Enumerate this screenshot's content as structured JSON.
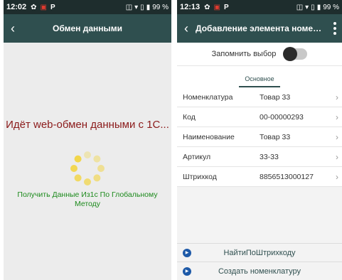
{
  "left": {
    "status": {
      "time": "12:02",
      "battery": "99 %"
    },
    "appbar": {
      "back_glyph": "‹",
      "title": "Обмен данными"
    },
    "message": "Идёт web-обмен данными с 1С...",
    "spinner_icon": "loading-spinner-icon",
    "sync_text": "Получить Данные Из1с По Глобальному Методу"
  },
  "right": {
    "status": {
      "time": "12:13",
      "battery": "99 %"
    },
    "appbar": {
      "back_glyph": "‹",
      "title": "Добавление элемента номенк..."
    },
    "remember": {
      "label": "Запомнить выбор",
      "checked": false
    },
    "tab": "Основное",
    "rows": [
      {
        "label": "Номенклатура",
        "value": "Товар 33"
      },
      {
        "label": "Код",
        "value": "00-00000293"
      },
      {
        "label": "Наименование",
        "value": "Товар 33"
      },
      {
        "label": "Артикул",
        "value": "33-33"
      },
      {
        "label": "Штрихкод",
        "value": "8856513000127"
      }
    ],
    "buttons": [
      {
        "label": "НайтиПоШтрихкоду"
      },
      {
        "label": "Создать номенклатуру"
      }
    ]
  },
  "colors": {
    "appbar": "#2f4f4f",
    "statusbar": "#1e2d2d",
    "loading_text": "#8b1a1a",
    "sync_text": "#1c8a1c",
    "spinner": "#f2d64b"
  }
}
